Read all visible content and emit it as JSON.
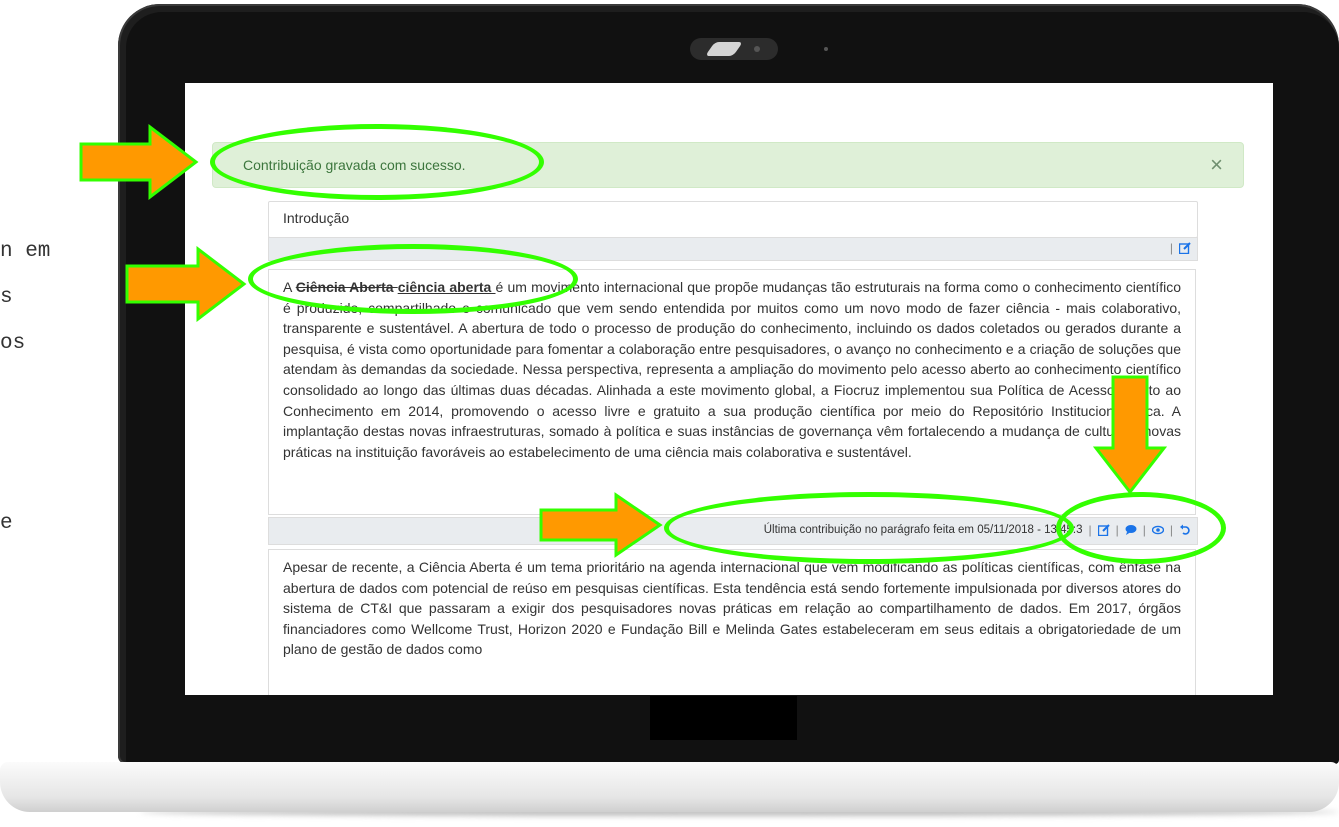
{
  "background_text": [
    "n em",
    "s",
    "os",
    "e"
  ],
  "alert": {
    "message": "Contribuição gravada com sucesso.",
    "close": "×"
  },
  "section_title": "Introdução",
  "paragraph1": {
    "prefix": "A ",
    "deleted": "Ciência Aberta ",
    "inserted": "ciência aberta ",
    "body": "é um movimento internacional que propõe mudanças tão estruturais na forma como o conhecimento científico é produzido, compartilhado e comunicado que vem sendo entendida por muitos como um novo modo de fazer ciência - mais colaborativo, transparente e sustentável. A abertura de todo o processo de produção do conhecimento, incluindo os dados coletados ou gerados durante a pesquisa, é vista como oportunidade para fomentar a colaboração entre pesquisadores, o avanço no conhecimento e a criação de soluções que atendam às demandas da sociedade. Nessa perspectiva, representa a ampliação do movimento pelo acesso aberto ao conhecimento científico consolidado ao longo das últimas duas décadas. Alinhada a este movimento global, a Fiocruz implementou sua Política de Acesso Aberto ao Conhecimento em 2014, promovendo o acesso livre e gratuito a sua produção científica por meio do Repositório Institucional Arca. A implantação destas novas infraestruturas, somado à política e suas instâncias de governança vêm fortalecendo a mudança de cultura e novas práticas na instituição favoráveis ao estabelecimento de uma ciência mais colaborativa e sustentável."
  },
  "paragraph1_footer": {
    "last_contribution": "Última contribuição no parágrafo feita em 05/11/2018 - 13:45:3",
    "separator": "|"
  },
  "paragraph2": {
    "body": "Apesar de recente, a Ciência Aberta é um tema prioritário na agenda internacional que vem modificando as políticas científicas, com ênfase na abertura de dados com potencial de reúso em pesquisas científicas. Esta tendência está sendo fortemente impulsionada por diversos atores do sistema de CT&I que passaram a exigir dos pesquisadores novas práticas em relação ao compartilhamento de dados. Em 2017, órgãos financiadores como Wellcome Trust, Horizon 2020 e Fundação Bill e Melinda Gates estabeleceram em seus editais a obrigatoriedade de um plano de gestão de dados como"
  },
  "icons": {
    "edit": "edit-icon",
    "comment": "comment-icon",
    "view": "eye-icon",
    "undo": "undo-icon"
  },
  "colors": {
    "annotation_oval": "#33ff00",
    "annotation_arrow": "#ff9900",
    "alert_bg": "#dff0d8",
    "alert_text": "#3c763d",
    "icon_blue": "#1a73e8"
  }
}
